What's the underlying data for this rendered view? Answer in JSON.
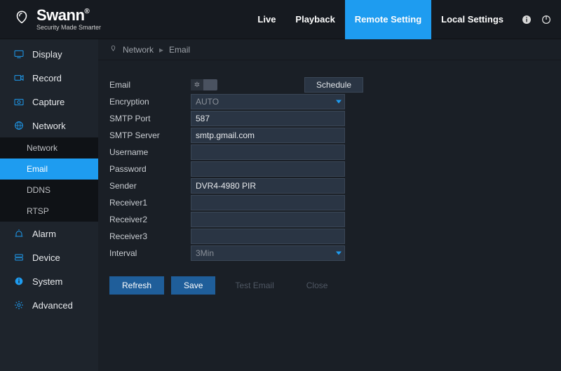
{
  "brand": {
    "name": "Swann",
    "regmark": "®",
    "tagline": "Security Made Smarter"
  },
  "nav": {
    "live": "Live",
    "playback": "Playback",
    "remote_setting": "Remote Setting",
    "local_settings": "Local Settings"
  },
  "sidebar": {
    "display": "Display",
    "record": "Record",
    "capture": "Capture",
    "network": "Network",
    "alarm": "Alarm",
    "device": "Device",
    "system": "System",
    "advanced": "Advanced",
    "sub": {
      "network": "Network",
      "email": "Email",
      "ddns": "DDNS",
      "rtsp": "RTSP"
    }
  },
  "breadcrumb": {
    "a": "Network",
    "b": "Email"
  },
  "form": {
    "labels": {
      "email": "Email",
      "encryption": "Encryption",
      "smtp_port": "SMTP Port",
      "smtp_server": "SMTP Server",
      "username": "Username",
      "password": "Password",
      "sender": "Sender",
      "receiver1": "Receiver1",
      "receiver2": "Receiver2",
      "receiver3": "Receiver3",
      "interval": "Interval"
    },
    "values": {
      "encryption": "AUTO",
      "smtp_port": "587",
      "smtp_server": "smtp.gmail.com",
      "username": "",
      "password": "",
      "sender": "DVR4-4980 PIR",
      "receiver1": "",
      "receiver2": "",
      "receiver3": "",
      "interval": "3Min"
    },
    "buttons": {
      "schedule": "Schedule",
      "refresh": "Refresh",
      "save": "Save",
      "test_email": "Test Email",
      "close": "Close"
    }
  }
}
